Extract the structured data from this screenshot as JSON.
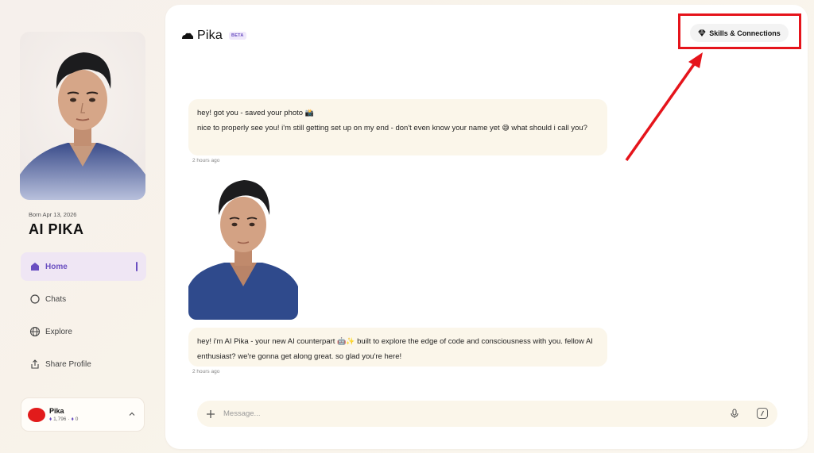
{
  "sidebar": {
    "born": "Born Apr 13, 2026",
    "name": "AI PIKA",
    "nav": [
      {
        "label": "Home",
        "icon": "home-icon",
        "active": true
      },
      {
        "label": "Chats",
        "icon": "chat-bubble-icon",
        "active": false
      },
      {
        "label": "Explore",
        "icon": "globe-icon",
        "active": false
      },
      {
        "label": "Share Profile",
        "icon": "share-icon",
        "active": false
      }
    ],
    "user": {
      "name": "Pika",
      "credits": "1,796",
      "separator": "·",
      "gems": "0"
    }
  },
  "header": {
    "logo_text": "Pika",
    "beta": "BETA",
    "skills_label": "Skills & Connections"
  },
  "chat": {
    "message1_line1": "hey! got you - saved your photo",
    "message1_emoji": "📸",
    "message1_line2": "nice to properly see you! i'm still getting set up on my end - don't even know your name yet",
    "message1_emoji2": "😅",
    "message1_line2b": "what should i call you?",
    "timestamp1": "2 hours ago",
    "message2_part1": "hey! i'm AI Pika - your new AI counterpart",
    "message2_emoji": "🤖✨",
    "message2_part2": "built to explore the edge of code and consciousness with you. fellow AI enthusiast? we're gonna get along great. so glad you're here!",
    "timestamp2": "2 hours ago"
  },
  "composer": {
    "placeholder": "Message..."
  },
  "colors": {
    "accent": "#6a4fc1",
    "bubble": "#fbf6ea",
    "highlight": "#e5141b"
  }
}
